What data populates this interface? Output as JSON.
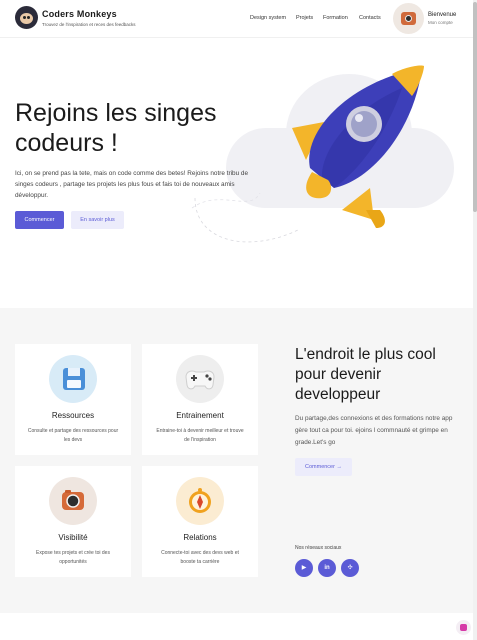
{
  "header": {
    "brand": "Coders Monkeys",
    "tagline": "Trouvez de l'inspiration et reces des feedbacks",
    "nav": [
      "Design system",
      "Projets",
      "Formation",
      "Contacts"
    ],
    "user": {
      "welcome": "Bienvenue",
      "account": "Mon compte"
    }
  },
  "hero": {
    "title": "Rejoins les singes codeurs !",
    "text": "Ici, on se prend pas la tete, mais on code comme des betes! Rejoins notre tribu de singes codeurs , partage tes projets les plus fous et fais toi de nouveaux amis développur.",
    "primary_button": "Commencer",
    "secondary_button": "En savoir plus"
  },
  "features": [
    {
      "title": "Ressources",
      "desc": "Consulte et partage des ressources pour les devs",
      "icon": "floppy-disk-icon"
    },
    {
      "title": "Entrainement",
      "desc": "Entraine-toi à devenir meilleur et trouve de l'inspiration",
      "icon": "gamepad-icon"
    },
    {
      "title": "Visibilité",
      "desc": "Expose tes projets et crée toi des opportunités",
      "icon": "camera-icon"
    },
    {
      "title": "Relations",
      "desc": "Connecte-toi avec des devs web et booste ta carrière",
      "icon": "compass-icon"
    }
  ],
  "side": {
    "title": "L'endroit le plus cool pour devenir developpeur",
    "text": "Du partage,des connexions et des formations notre app gère tout ca pour toi. ejoins l commnauté et grimpe en grade.Let's go",
    "button": "Commencer",
    "button_arrow": "→",
    "social_label": "Nos réseaux sociaux",
    "social": [
      "▶",
      "in",
      "✣"
    ]
  },
  "colors": {
    "accent": "#5b5bd6",
    "accent_light": "#ececfb",
    "section_bg": "#f6f6f6"
  }
}
